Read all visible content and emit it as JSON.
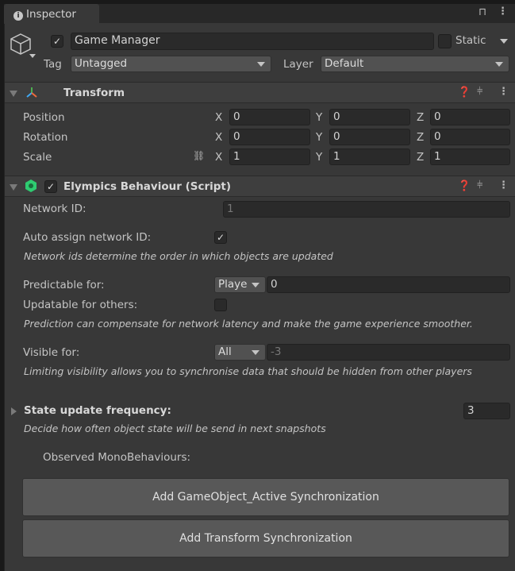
{
  "tab": {
    "title": "Inspector"
  },
  "object": {
    "name": "Game Manager",
    "active": true,
    "static_label": "Static",
    "tag_label": "Tag",
    "tag": "Untagged",
    "layer_label": "Layer",
    "layer": "Default"
  },
  "transform": {
    "title": "Transform",
    "rows": [
      {
        "label": "Position",
        "x": "0",
        "y": "0",
        "z": "0"
      },
      {
        "label": "Rotation",
        "x": "0",
        "y": "0",
        "z": "0"
      },
      {
        "label": "Scale",
        "x": "1",
        "y": "1",
        "z": "1"
      }
    ],
    "axis": {
      "x": "X",
      "y": "Y",
      "z": "Z"
    }
  },
  "elympics": {
    "title": "Elympics Behaviour (Script)",
    "enabled": true,
    "network_id_label": "Network ID:",
    "network_id": "1",
    "auto_assign_label": "Auto assign network ID:",
    "auto_assign": true,
    "help1": "Network ids determine the order in which objects are updated",
    "predictable_label": "Predictable for:",
    "predictable_option": "Playe",
    "predictable_value": "0",
    "updatable_label": "Updatable for others:",
    "updatable": false,
    "help2": "Prediction can compensate for network latency and make the game experience smoother.",
    "visible_label": "Visible for:",
    "visible_option": "All",
    "visible_value": "-3",
    "help3": "Limiting visibility allows you to synchronise data that should be hidden from other players",
    "state_freq_label": "State update frequency:",
    "state_freq": "3",
    "help4": "Decide how often object state will be send in next snapshots",
    "observed_label": "Observed MonoBehaviours:",
    "btn_active": "Add GameObject_Active Synchronization",
    "btn_transform": "Add Transform Synchronization"
  },
  "colors": {
    "background": "#383838",
    "field": "#2a2a2a",
    "button": "#585858",
    "elympics_icon": "#2ecc71"
  }
}
